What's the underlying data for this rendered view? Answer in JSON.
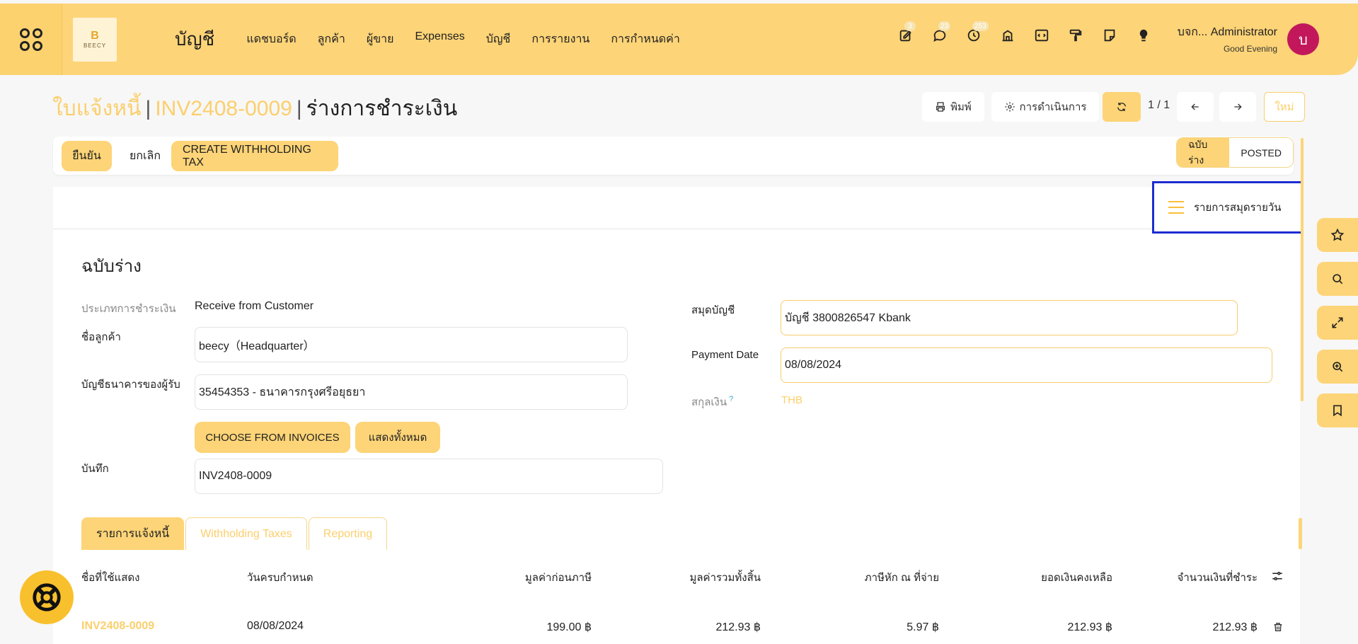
{
  "navbar": {
    "brand_text": "BEECY",
    "brand_letter": "B",
    "app_name": "บัญชี",
    "menu": [
      "แดชบอร์ด",
      "ลูกค้า",
      "ผู้ขาย",
      "Expenses",
      "บัญชี",
      "การรายงาน",
      "การกำหนดค่า"
    ],
    "badges": {
      "activity": "3",
      "messages": "23",
      "notifications": "253"
    },
    "user_name": "บจก... Administrator",
    "greeting": "Good Evening",
    "avatar_letter": "บ"
  },
  "header": {
    "crumb1": "ใบแจ้งหนี้",
    "crumb2": "INV2408-0009",
    "current": "ร่างการชำระเงิน",
    "print_label": "พิมพ์",
    "action_label": "การดำเนินการ",
    "pager": "1 / 1",
    "new_label": "ใหม่"
  },
  "actions": {
    "confirm": "ยืนยัน",
    "cancel": "ยกเลิก",
    "create_wht": "CREATE WITHHOLDING TAX",
    "status_draft": "ฉบับร่าง",
    "status_posted": "POSTED"
  },
  "form": {
    "journal_items_label": "รายการสมุดรายวัน",
    "title": "ฉบับร่าง",
    "payment_type_label": "ประเภทการชำระเงิน",
    "payment_type_value": "Receive from Customer",
    "customer_label": "ชื่อลูกค้า",
    "customer_value": "beecy（Headquarter）",
    "bank_label": "บัญชีธนาคารของผู้รับ",
    "bank_value": "35454353 - ธนาคารกรุงศรีอยุธยา",
    "choose_invoices": "CHOOSE FROM INVOICES",
    "show_all": "แสดงทั้งหมด",
    "memo_label": "บันทึก",
    "memo_value": "INV2408-0009",
    "journal_label": "สมุดบัญชี",
    "journal_value": "บัญชี 3800826547 Kbank",
    "payment_date_label": "Payment Date",
    "payment_date_value": "08/08/2024",
    "currency_label": "สกุลเงิน",
    "currency_help": "?",
    "currency_value": "THB"
  },
  "tabs": [
    "รายการแจ้งหนี้",
    "Withholding Taxes",
    "Reporting"
  ],
  "table": {
    "columns": [
      "ชื่อที่ใช้แสดง",
      "วันครบกำหนด",
      "มูลค่าก่อนภาษี",
      "มูลค่ารวมทั้งสิ้น",
      "ภาษีหัก ณ ที่จ่าย",
      "ยอดเงินคงเหลือ",
      "จำนวนเงินที่ชำระ"
    ],
    "row": [
      "INV2408-0009",
      "08/08/2024",
      "199.00 ฿",
      "212.93 ฿",
      "5.97 ฿",
      "212.93 ฿",
      "212.93 ฿"
    ]
  },
  "colors": {
    "accent": "#fdd477",
    "link": "#fbcf6c",
    "highlight_border": "#1d2cd0",
    "avatar": "#c2185b"
  }
}
